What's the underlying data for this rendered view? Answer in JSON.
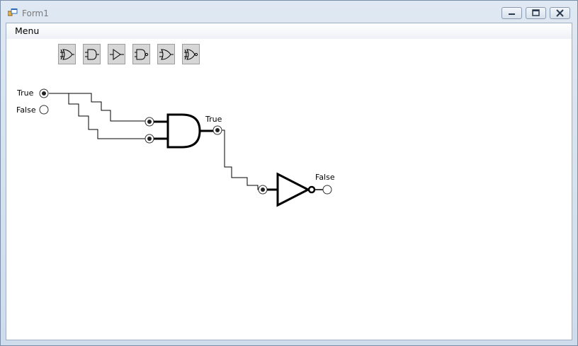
{
  "window": {
    "title": "Form1"
  },
  "menu": {
    "label": "Menu"
  },
  "toolbar": {
    "tools": [
      {
        "icon": "xor-gate-icon"
      },
      {
        "icon": "and-gate-icon"
      },
      {
        "icon": "buffer-gate-icon"
      },
      {
        "icon": "nand-gate-icon"
      },
      {
        "icon": "or-gate-icon"
      },
      {
        "icon": "xnor-gate-icon"
      }
    ]
  },
  "input": {
    "true_label": "True",
    "false_label": "False",
    "selected": "True"
  },
  "and_gate": {
    "output_label": "True"
  },
  "not_gate": {
    "output_label": "False"
  }
}
